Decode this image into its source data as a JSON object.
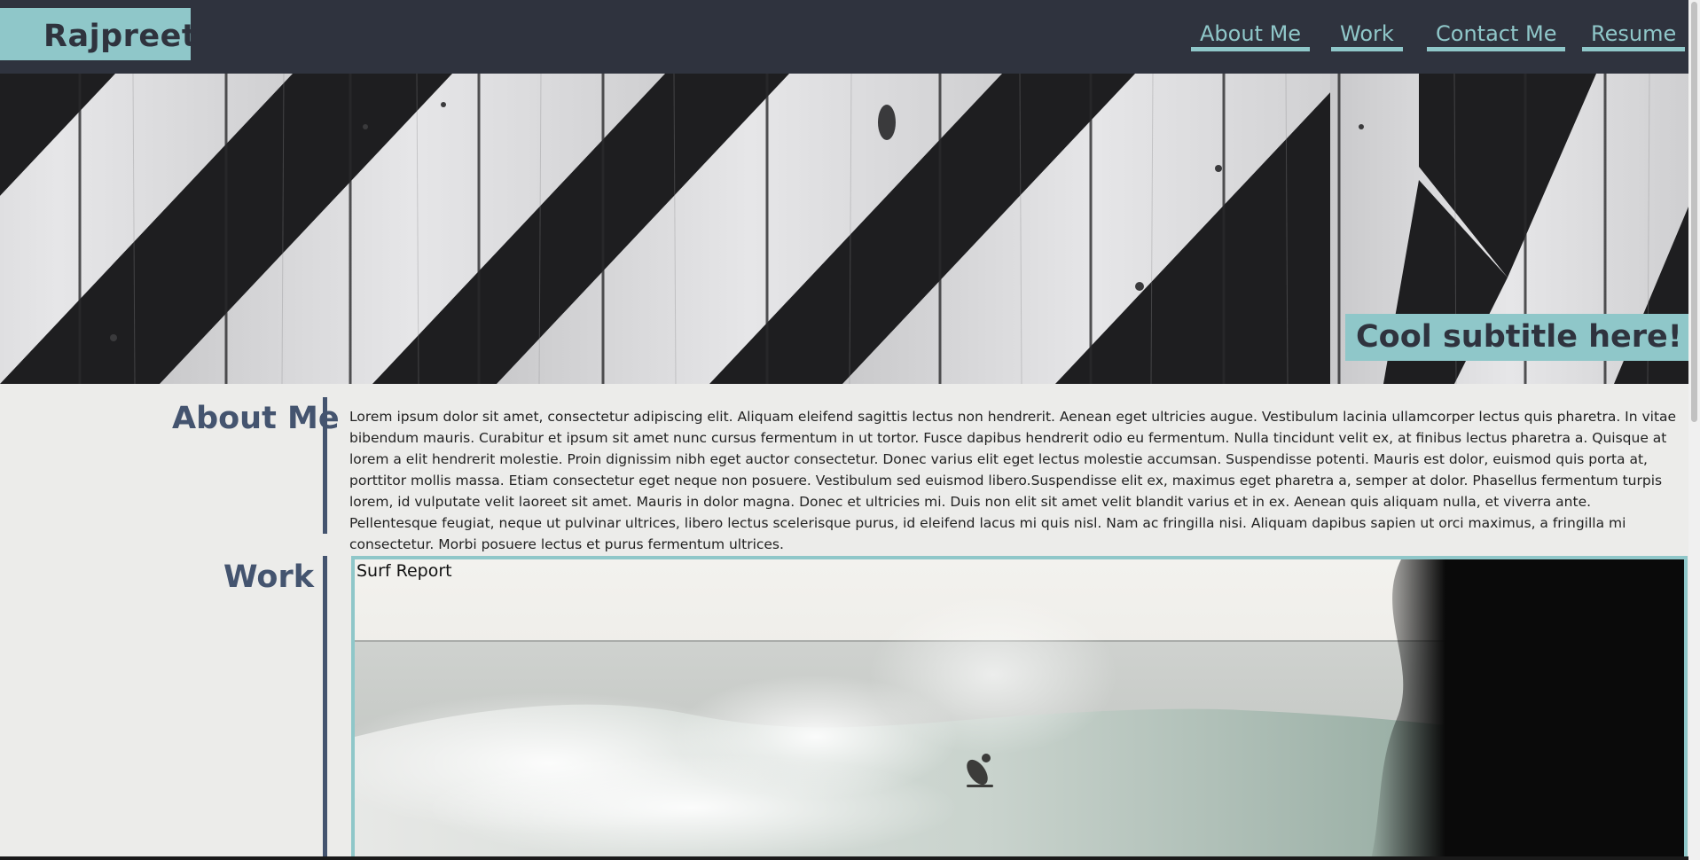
{
  "header": {
    "brand": "Rajpreet",
    "nav": [
      {
        "label": "About Me"
      },
      {
        "label": "Work"
      },
      {
        "label": "Contact Me"
      },
      {
        "label": "Resume"
      }
    ]
  },
  "hero": {
    "subtitle": "Cool subtitle here!"
  },
  "about": {
    "title": "About Me",
    "body": "Lorem ipsum dolor sit amet, consectetur adipiscing elit. Aliquam eleifend sagittis lectus non hendrerit. Aenean eget ultricies augue. Vestibulum lacinia ullamcorper lectus quis pharetra. In vitae bibendum mauris. Curabitur et ipsum sit amet nunc cursus fermentum in ut tortor. Fusce dapibus hendrerit odio eu fermentum. Nulla tincidunt velit ex, at finibus lectus pharetra a. Quisque at lorem a elit hendrerit molestie. Proin dignissim nibh eget auctor consectetur. Donec varius elit eget lectus molestie accumsan. Suspendisse potenti. Mauris est dolor, euismod quis porta at, porttitor mollis massa. Etiam consectetur eget neque non posuere. Vestibulum sed euismod libero.Suspendisse elit ex, maximus eget pharetra a, semper at dolor. Phasellus fermentum turpis lorem, id vulputate velit laoreet sit amet. Mauris in dolor magna. Donec et ultricies mi. Duis non elit sit amet velit blandit varius et in ex. Aenean quis aliquam nulla, et viverra ante. Pellentesque feugiat, neque ut pulvinar ultrices, libero lectus scelerisque purus, id eleifend lacus mi quis nisl. Nam ac fringilla nisi. Aliquam dapibus sapien ut orci maximus, a fringilla mi consectetur. Morbi posuere lectus et purus fermentum ultrices."
  },
  "work": {
    "title": "Work",
    "projects": [
      {
        "title": "Surf Report"
      }
    ]
  },
  "colors": {
    "header_bg": "#2f333e",
    "accent": "#8fc7c9",
    "heading": "#44546f",
    "page_bg": "#ececea"
  }
}
